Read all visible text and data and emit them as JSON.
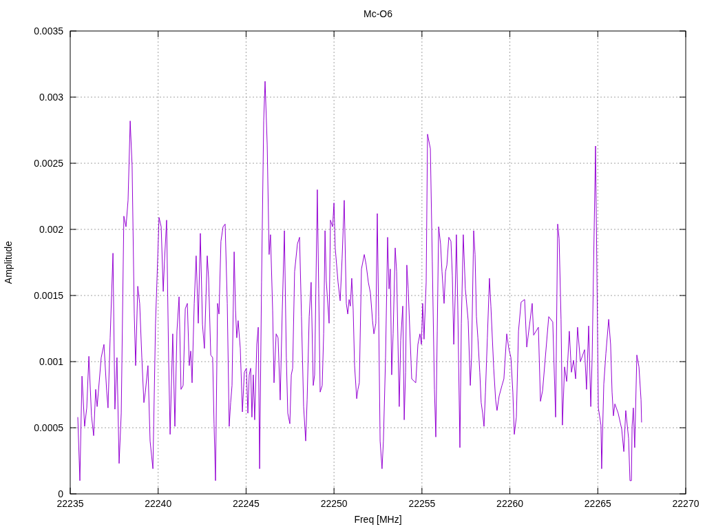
{
  "chart_data": {
    "type": "line",
    "grid": true,
    "title": "Mc-O6",
    "xlabel": "Freq [MHz]",
    "ylabel": "Amplitude",
    "xlim": [
      22235,
      22270
    ],
    "ylim": [
      0,
      0.0035
    ],
    "xticks": [
      22235,
      22240,
      22245,
      22250,
      22255,
      22260,
      22265,
      22270
    ],
    "yticks": [
      {
        "value": 0,
        "label": "0"
      },
      {
        "value": 0.0005,
        "label": "0.0005"
      },
      {
        "value": 0.001,
        "label": "0.001"
      },
      {
        "value": 0.0015,
        "label": "0.0015"
      },
      {
        "value": 0.002,
        "label": "0.002"
      },
      {
        "value": 0.0025,
        "label": "0.0025"
      },
      {
        "value": 0.003,
        "label": "0.003"
      },
      {
        "value": 0.0035,
        "label": "0.0035"
      }
    ],
    "x": [
      22235.43,
      22235.55,
      22235.67,
      22235.82,
      22235.94,
      22236.06,
      22236.21,
      22236.33,
      22236.45,
      22236.53,
      22236.76,
      22236.92,
      22237.07,
      22237.15,
      22237.27,
      22237.43,
      22237.54,
      22237.66,
      22237.78,
      22237.9,
      22238.05,
      22238.17,
      22238.29,
      22238.41,
      22238.52,
      22238.64,
      22238.72,
      22238.84,
      22238.95,
      22239.07,
      22239.19,
      22239.27,
      22239.42,
      22239.54,
      22239.7,
      22239.85,
      22240.05,
      22240.17,
      22240.29,
      22240.36,
      22240.48,
      22240.6,
      22240.68,
      22240.83,
      22240.95,
      22241.07,
      22241.19,
      22241.3,
      22241.42,
      22241.54,
      22241.66,
      22241.77,
      22241.85,
      22241.93,
      22242.05,
      22242.16,
      22242.28,
      22242.4,
      22242.52,
      22242.63,
      22242.79,
      22242.87,
      22242.99,
      22243.1,
      22243.18,
      22243.26,
      22243.38,
      22243.46,
      22243.57,
      22243.69,
      22243.81,
      22243.93,
      22244.04,
      22244.12,
      22244.2,
      22244.32,
      22244.4,
      22244.47,
      22244.55,
      22244.67,
      22244.79,
      22244.9,
      22245.02,
      22245.1,
      22245.18,
      22245.26,
      22245.33,
      22245.41,
      22245.49,
      22245.61,
      22245.69,
      22245.77,
      22245.88,
      22246.0,
      22246.08,
      22246.2,
      22246.31,
      22246.39,
      22246.51,
      22246.59,
      22246.71,
      22246.82,
      22246.94,
      22247.06,
      22247.18,
      22247.29,
      22247.37,
      22247.49,
      22247.57,
      22247.65,
      22247.76,
      22247.92,
      22248.04,
      22248.15,
      22248.27,
      22248.39,
      22248.47,
      22248.59,
      22248.7,
      22248.82,
      22248.9,
      22249.05,
      22249.13,
      22249.21,
      22249.33,
      22249.41,
      22249.49,
      22249.56,
      22249.72,
      22249.8,
      22249.92,
      22250.0,
      22250.07,
      22250.23,
      22250.35,
      22250.46,
      22250.58,
      22250.7,
      22250.78,
      22250.86,
      22250.93,
      22251.01,
      22251.09,
      22251.17,
      22251.29,
      22251.36,
      22251.44,
      22251.56,
      22251.72,
      22251.83,
      22251.95,
      22252.07,
      22252.19,
      22252.27,
      22252.38,
      22252.46,
      22252.54,
      22252.62,
      22252.73,
      22252.81,
      22252.93,
      22253.05,
      22253.13,
      22253.2,
      22253.28,
      22253.36,
      22253.48,
      22253.56,
      22253.64,
      22253.71,
      22253.79,
      22253.91,
      22253.99,
      22254.07,
      22254.14,
      22254.22,
      22254.42,
      22254.65,
      22254.77,
      22254.89,
      22254.97,
      22255.04,
      22255.12,
      22255.24,
      22255.32,
      22255.48,
      22255.59,
      22255.71,
      22255.79,
      22255.87,
      22255.95,
      22256.06,
      22256.14,
      22256.26,
      22256.34,
      22256.42,
      22256.53,
      22256.65,
      22256.73,
      22256.81,
      22256.89,
      22256.96,
      22257.04,
      22257.16,
      22257.24,
      22257.35,
      22257.47,
      22257.63,
      22257.75,
      22257.82,
      22257.94,
      22258.02,
      22258.1,
      22258.18,
      22258.29,
      22258.37,
      22258.45,
      22258.53,
      22258.61,
      22258.72,
      22258.84,
      22258.92,
      22259.08,
      22259.19,
      22259.27,
      22259.39,
      22259.55,
      22259.66,
      22259.82,
      22259.94,
      22260.06,
      22260.17,
      22260.25,
      22260.37,
      22260.49,
      22260.64,
      22260.84,
      22260.96,
      22261.27,
      22261.35,
      22261.62,
      22261.74,
      22261.86,
      22262.21,
      22262.44,
      22262.6,
      22262.72,
      22262.8,
      22262.91,
      22262.99,
      22263.11,
      22263.23,
      22263.38,
      22263.5,
      22263.62,
      22263.74,
      22263.85,
      22264.01,
      22264.25,
      22264.36,
      22264.48,
      22264.6,
      22264.68,
      22264.75,
      22264.87,
      22264.95,
      22265.03,
      22265.18,
      22265.22,
      22265.34,
      22265.46,
      22265.62,
      22265.73,
      22265.81,
      22265.89,
      22265.97,
      22266.16,
      22266.36,
      22266.48,
      22266.59,
      22266.75,
      22266.83,
      22266.91,
      22266.95,
      22267.02,
      22267.1,
      22267.22,
      22267.34,
      22267.46,
      22267.49
    ],
    "series": [
      {
        "color": "#9400d3",
        "values": [
          0.00058,
          0.0001,
          0.00089,
          0.00051,
          0.00065,
          0.00104,
          0.00059,
          0.00044,
          0.00079,
          0.00066,
          0.00103,
          0.00113,
          0.00078,
          0.00065,
          0.00118,
          0.00182,
          0.00064,
          0.00103,
          0.00023,
          0.00061,
          0.0021,
          0.00202,
          0.00222,
          0.00282,
          0.00248,
          0.00136,
          0.00097,
          0.00157,
          0.00144,
          0.00103,
          0.00069,
          0.00077,
          0.00097,
          0.0004,
          0.00019,
          0.00129,
          0.00209,
          0.00202,
          0.00153,
          0.00176,
          0.00207,
          0.001,
          0.00045,
          0.00121,
          0.00051,
          0.00123,
          0.00149,
          0.00079,
          0.00082,
          0.0014,
          0.00144,
          0.00097,
          0.00108,
          0.00084,
          0.00144,
          0.0018,
          0.00129,
          0.00197,
          0.00128,
          0.0011,
          0.0018,
          0.00163,
          0.00105,
          0.00103,
          0.00053,
          0.0001,
          0.00144,
          0.00136,
          0.00191,
          0.00202,
          0.00204,
          0.00144,
          0.00051,
          0.00069,
          0.00082,
          0.00183,
          0.00139,
          0.00118,
          0.00131,
          0.0011,
          0.00062,
          0.00092,
          0.00095,
          0.00061,
          0.0009,
          0.00095,
          0.00058,
          0.0009,
          0.00056,
          0.00113,
          0.00126,
          0.00019,
          0.0016,
          0.00282,
          0.00312,
          0.00264,
          0.00181,
          0.00196,
          0.00139,
          0.00084,
          0.00121,
          0.00118,
          0.00071,
          0.00139,
          0.00199,
          0.00103,
          0.00061,
          0.00053,
          0.0009,
          0.00095,
          0.00168,
          0.00189,
          0.00194,
          0.00134,
          0.00066,
          0.0004,
          0.00071,
          0.00134,
          0.0016,
          0.00082,
          0.0009,
          0.0023,
          0.00155,
          0.00077,
          0.00082,
          0.00121,
          0.00199,
          0.00161,
          0.00129,
          0.00207,
          0.00202,
          0.0022,
          0.00186,
          0.0016,
          0.00146,
          0.00178,
          0.00222,
          0.00144,
          0.00136,
          0.00147,
          0.00142,
          0.00163,
          0.00139,
          0.00097,
          0.00072,
          0.00079,
          0.00084,
          0.0017,
          0.00181,
          0.00173,
          0.0016,
          0.00152,
          0.00131,
          0.00121,
          0.00129,
          0.00212,
          0.00134,
          0.0004,
          0.00019,
          0.0004,
          0.00103,
          0.00194,
          0.00155,
          0.0017,
          0.0009,
          0.00121,
          0.00186,
          0.00168,
          0.00113,
          0.00066,
          0.00116,
          0.00142,
          0.00056,
          0.00092,
          0.00173,
          0.00155,
          0.00087,
          0.00084,
          0.00113,
          0.00121,
          0.00113,
          0.00144,
          0.00117,
          0.0016,
          0.00272,
          0.00261,
          0.00176,
          0.00079,
          0.00043,
          0.00123,
          0.00202,
          0.00189,
          0.00168,
          0.00144,
          0.00168,
          0.00173,
          0.00194,
          0.00191,
          0.00165,
          0.00113,
          0.00149,
          0.00196,
          0.00139,
          0.00035,
          0.00129,
          0.00196,
          0.00155,
          0.00131,
          0.00082,
          0.00103,
          0.00199,
          0.00181,
          0.00134,
          0.00118,
          0.00092,
          0.00069,
          0.00061,
          0.00051,
          0.00077,
          0.00118,
          0.00163,
          0.00142,
          0.00095,
          0.00071,
          0.00063,
          0.00074,
          0.00082,
          0.00087,
          0.00121,
          0.0011,
          0.00103,
          0.00077,
          0.00045,
          0.00058,
          0.00123,
          0.00145,
          0.00147,
          0.00111,
          0.00144,
          0.0012,
          0.00126,
          0.0007,
          0.00078,
          0.00134,
          0.0013,
          0.00058,
          0.00204,
          0.00193,
          0.00132,
          0.00052,
          0.00096,
          0.00085,
          0.00123,
          0.00092,
          0.00101,
          0.00087,
          0.00126,
          0.001,
          0.00109,
          0.00079,
          0.00127,
          0.00066,
          0.00103,
          0.00164,
          0.00263,
          0.00167,
          0.00065,
          0.00052,
          0.00019,
          0.00083,
          0.00106,
          0.00132,
          0.00113,
          0.00077,
          0.00059,
          0.00068,
          0.00061,
          0.00049,
          0.00032,
          0.00063,
          0.00042,
          0.0001,
          0.0001,
          0.00051,
          0.00065,
          0.00035,
          0.00105,
          0.00096,
          0.00071,
          0.00054
        ]
      }
    ]
  }
}
